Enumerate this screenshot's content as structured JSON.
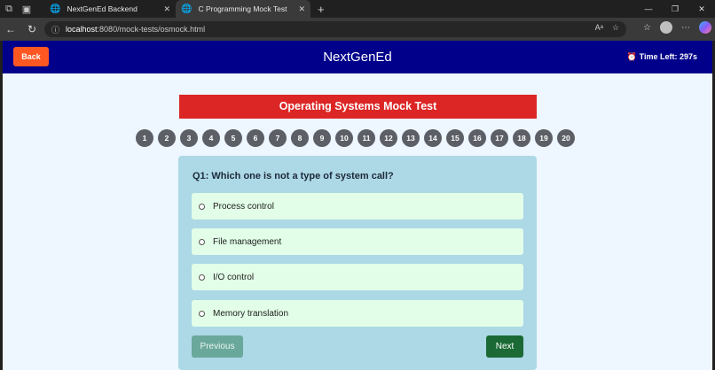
{
  "browser": {
    "tabs": [
      {
        "title": "NextGenEd Backend"
      },
      {
        "title": "C Programming Mock Test"
      }
    ],
    "url_host": "localhost",
    "url_rest": ":8080/mock-tests/osmock.html"
  },
  "header": {
    "back_label": "Back",
    "site_title": "NextGenEd",
    "timer_text": "⏰ Time Left: 297s"
  },
  "test": {
    "title": "Operating Systems Mock Test",
    "question_numbers": [
      "1",
      "2",
      "3",
      "4",
      "5",
      "6",
      "7",
      "8",
      "9",
      "10",
      "11",
      "12",
      "13",
      "14",
      "15",
      "16",
      "17",
      "18",
      "19",
      "20"
    ],
    "question": "Q1: Which one is not a type of system call?",
    "options": [
      "Process control",
      "File management",
      "I/O control",
      "Memory translation"
    ],
    "prev_label": "Previous",
    "next_label": "Next"
  },
  "colors": {
    "header_bg": "#00008b",
    "back_btn": "#ff5722",
    "title_bar": "#dc2626",
    "card_bg": "#add8e6",
    "option_bg": "#e2fee8",
    "next_btn": "#1b6a35"
  }
}
